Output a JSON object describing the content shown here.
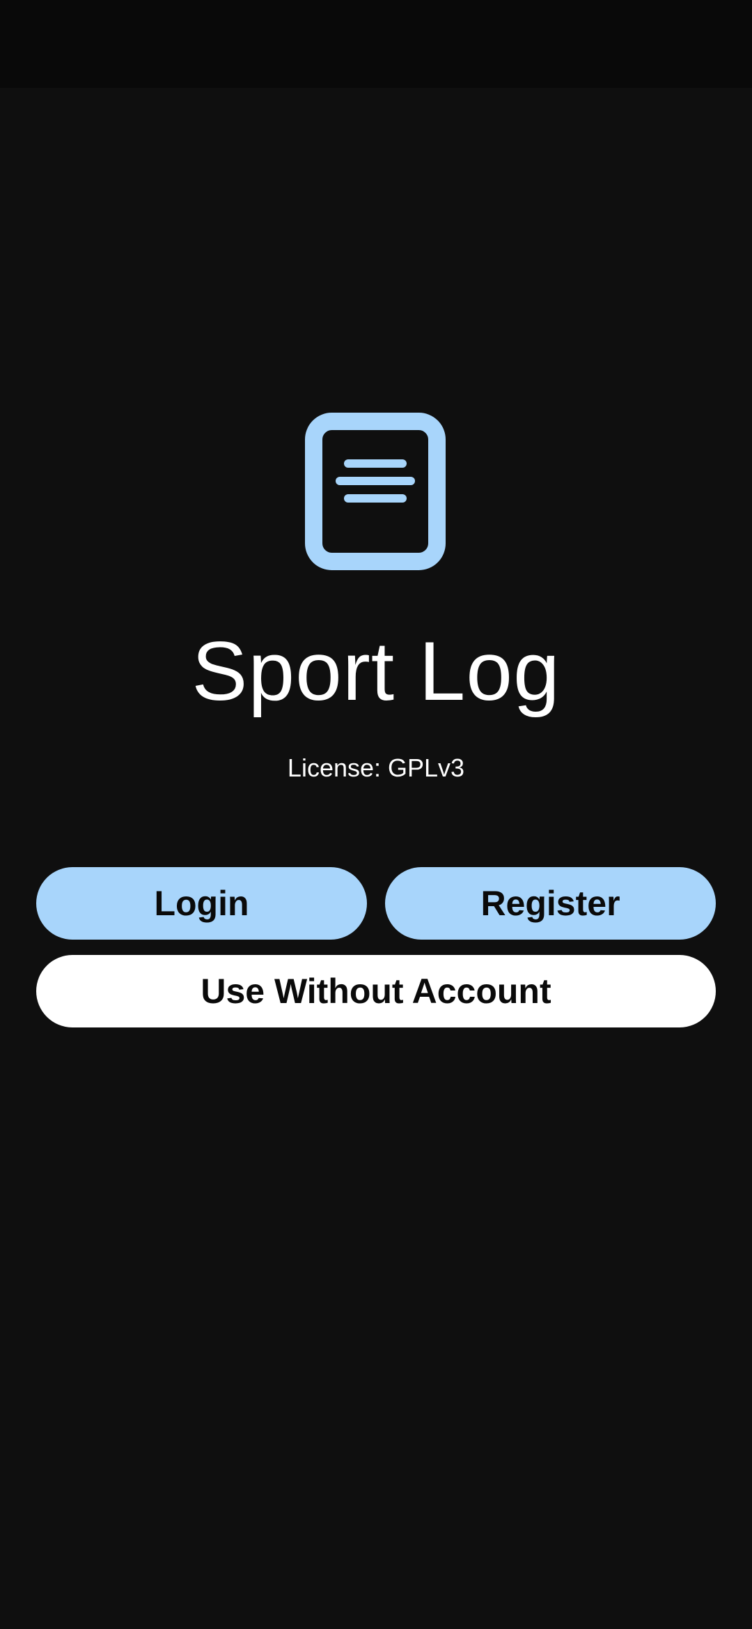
{
  "app": {
    "title": "Sport Log",
    "license": "License: GPLv3",
    "logo_icon": "document-icon"
  },
  "colors": {
    "background": "#0f0f0f",
    "status_bar": "#090909",
    "accent": "#a8d5fb",
    "text": "#ffffff",
    "button_text": "#0a0a0a"
  },
  "actions": {
    "login_label": "Login",
    "register_label": "Register",
    "guest_label": "Use Without Account"
  }
}
